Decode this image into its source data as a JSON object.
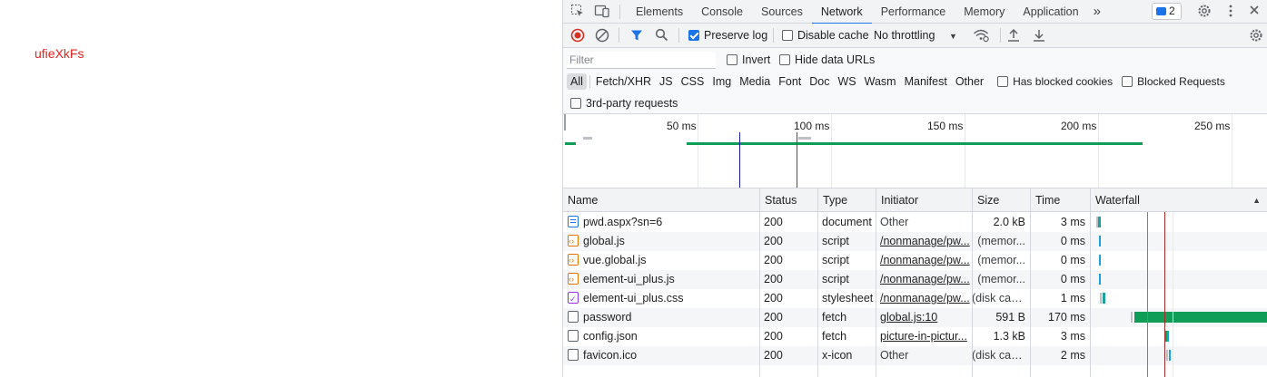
{
  "page": {
    "text": "ufieXkFs"
  },
  "devtools": {
    "tabs": [
      "Elements",
      "Console",
      "Sources",
      "Network",
      "Performance",
      "Memory",
      "Application"
    ],
    "active_tab": "Network",
    "more_tabs": "»",
    "issues_count": "2",
    "toolbar": {
      "preserve_log": "Preserve log",
      "preserve_log_checked": true,
      "disable_cache": "Disable cache",
      "disable_cache_checked": false,
      "throttling": "No throttling"
    },
    "filter": {
      "placeholder": "Filter",
      "invert": "Invert",
      "hide_data_urls": "Hide data URLs",
      "types": [
        "All",
        "Fetch/XHR",
        "JS",
        "CSS",
        "Img",
        "Media",
        "Font",
        "Doc",
        "WS",
        "Wasm",
        "Manifest",
        "Other"
      ],
      "active_type": "All",
      "has_blocked_cookies": "Has blocked cookies",
      "blocked_requests": "Blocked Requests",
      "third_party": "3rd-party requests"
    },
    "overview": {
      "ticks": [
        "50 ms",
        "100 ms",
        "150 ms",
        "200 ms",
        "250 ms"
      ]
    },
    "table": {
      "columns": [
        "Name",
        "Status",
        "Type",
        "Initiator",
        "Size",
        "Time",
        "Waterfall"
      ],
      "rows": [
        {
          "name": "pwd.aspx?sn=6",
          "icon": "document-icon",
          "status": "200",
          "type": "document",
          "initiator": "Other",
          "initiator_link": false,
          "size": "2.0 kB",
          "time": "3 ms"
        },
        {
          "name": "global.js",
          "icon": "script-icon",
          "status": "200",
          "type": "script",
          "initiator": "/nonmanage/pw...",
          "initiator_link": true,
          "size": "(memor...",
          "time": "0 ms"
        },
        {
          "name": "vue.global.js",
          "icon": "script-icon",
          "status": "200",
          "type": "script",
          "initiator": "/nonmanage/pw...",
          "initiator_link": true,
          "size": "(memor...",
          "time": "0 ms"
        },
        {
          "name": "element-ui_plus.js",
          "icon": "script-icon",
          "status": "200",
          "type": "script",
          "initiator": "/nonmanage/pw...",
          "initiator_link": true,
          "size": "(memor...",
          "time": "0 ms"
        },
        {
          "name": "element-ui_plus.css",
          "icon": "stylesheet-icon",
          "status": "200",
          "type": "stylesheet",
          "initiator": "/nonmanage/pw...",
          "initiator_link": true,
          "size": "(disk cac...",
          "time": "1 ms"
        },
        {
          "name": "password",
          "icon": "file-icon",
          "status": "200",
          "type": "fetch",
          "initiator": "global.js:10",
          "initiator_link": true,
          "size": "591 B",
          "time": "170 ms"
        },
        {
          "name": "config.json",
          "icon": "file-icon",
          "status": "200",
          "type": "fetch",
          "initiator": "picture-in-pictur...",
          "initiator_link": true,
          "size": "1.3 kB",
          "time": "3 ms"
        },
        {
          "name": "favicon.ico",
          "icon": "file-icon",
          "status": "200",
          "type": "x-icon",
          "initiator": "Other",
          "initiator_link": false,
          "size": "(disk cac...",
          "time": "2 ms"
        }
      ]
    },
    "colors": {
      "accent": "#1a73e8",
      "dom_content_loaded": "#1a1aa6",
      "load": "#a52a2a",
      "waiting": "#0f9d58",
      "download": "#1a9fe0"
    }
  }
}
